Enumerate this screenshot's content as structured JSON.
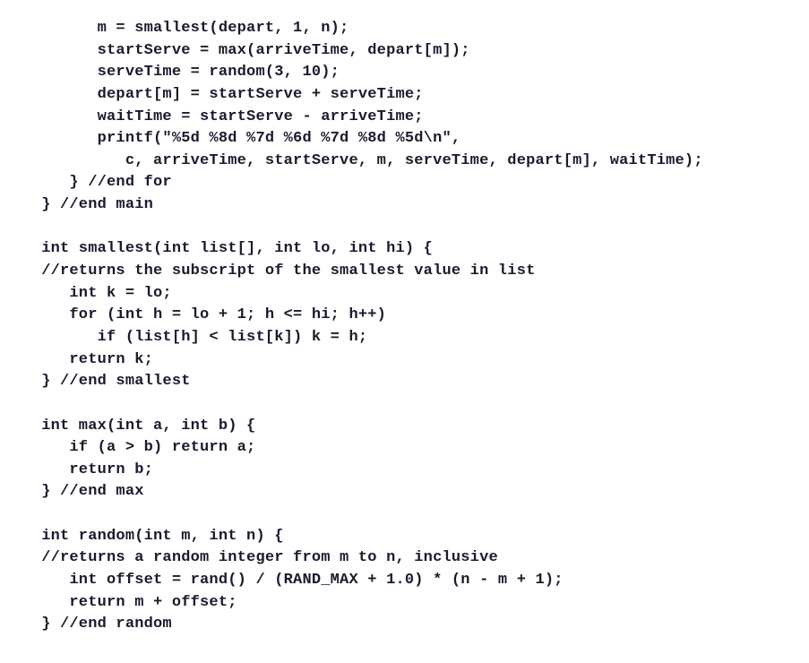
{
  "code": {
    "lines": [
      "         m = smallest(depart, 1, n);",
      "         startServe = max(arriveTime, depart[m]);",
      "         serveTime = random(3, 10);",
      "         depart[m] = startServe + serveTime;",
      "         waitTime = startServe - arriveTime;",
      "         printf(\"%5d %8d %7d %6d %7d %8d %5d\\n\",",
      "            c, arriveTime, startServe, m, serveTime, depart[m], waitTime);",
      "      } //end for",
      "   } //end main",
      "",
      "   int smallest(int list[], int lo, int hi) {",
      "   //returns the subscript of the smallest value in list",
      "      int k = lo;",
      "      for (int h = lo + 1; h <= hi; h++)",
      "         if (list[h] < list[k]) k = h;",
      "      return k;",
      "   } //end smallest",
      "",
      "   int max(int a, int b) {",
      "      if (a > b) return a;",
      "      return b;",
      "   } //end max",
      "",
      "   int random(int m, int n) {",
      "   //returns a random integer from m to n, inclusive",
      "      int offset = rand() / (RAND_MAX + 1.0) * (n - m + 1);",
      "      return m + offset;",
      "   } //end random"
    ]
  }
}
